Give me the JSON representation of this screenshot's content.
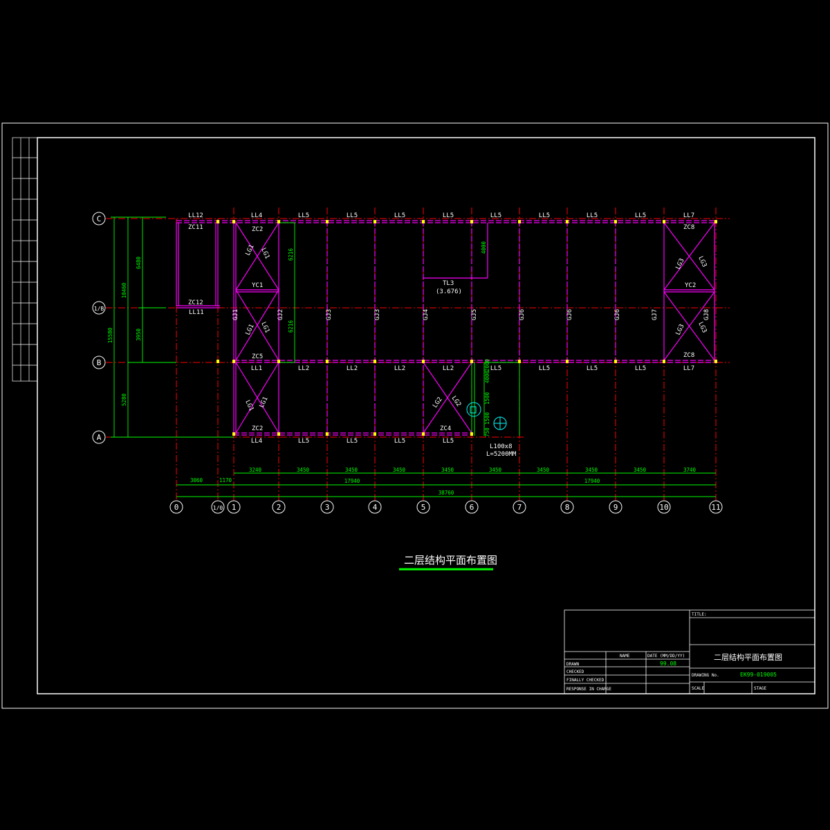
{
  "drawing_title": "二层结构平面布置图",
  "axes": {
    "columns": [
      "0",
      "1/0",
      "1",
      "2",
      "3",
      "4",
      "5",
      "6",
      "7",
      "8",
      "9",
      "10",
      "11"
    ],
    "rows": [
      "C",
      "1/B",
      "B",
      "A"
    ]
  },
  "beams_top": [
    "LL12",
    "LL4",
    "LL5",
    "LL5",
    "LL5",
    "LL5",
    "LL5",
    "LL5",
    "LL5",
    "LL5",
    "LL7"
  ],
  "beams_mid": [
    "LL1",
    "LL2",
    "LL2",
    "LL2",
    "LL2",
    "LL5",
    "LL5",
    "LL5",
    "LL5",
    "LL7"
  ],
  "beams_bottom": [
    "LL4",
    "LL5",
    "LL5",
    "LL5",
    "LL5"
  ],
  "beam_ll11": "LL11",
  "frames": [
    "GJ1",
    "GJ2",
    "GJ3",
    "GJ3",
    "GJ4",
    "GJ5",
    "GJ6",
    "GJ6",
    "GJ6",
    "GJ7",
    "GJ8"
  ],
  "braces": {
    "zc11": "ZC11",
    "zc12": "ZC12",
    "zc2": "ZC2",
    "zc5": "ZC5",
    "zc4": "ZC4",
    "zc8": "ZC8",
    "yc1": "YC1",
    "yc2": "YC2",
    "lg1": "LG1",
    "lg2": "LG2",
    "lg3": "LG3"
  },
  "tl3": {
    "name": "TL3",
    "elevation": "(3.676)"
  },
  "angle_note": {
    "size": "L100x8",
    "length": "L=5200MM"
  },
  "dims": {
    "bottom_row1": [
      "3060",
      "1170",
      "3240",
      "3450",
      "3450",
      "3450",
      "3450",
      "3450",
      "3450",
      "3450",
      "3450",
      "3740"
    ],
    "bottom_row2": [
      "17940",
      "17940"
    ],
    "bottom_total": "38760",
    "left_inner": [
      "6480",
      "3950",
      "5280"
    ],
    "left_mid": "10460",
    "left_total": "15580",
    "interior": [
      "6216",
      "6216",
      "4000",
      "4000",
      "2000",
      "1500",
      "1500",
      "750"
    ]
  },
  "title_block": {
    "title_label": "TITLE:",
    "name_header": "NAME",
    "date_header": "DATE (MM/DD/YY)",
    "rows": [
      "DRAWN",
      "CHECKED",
      "FINALLY CHECKED",
      "RESPONSE IN CHARGE"
    ],
    "date_value": "99.08",
    "drawing_name": "二层结构平面布置图",
    "drawing_no_label": "DRAWING No.",
    "drawing_no": "EK99-019005",
    "scale_label": "SCALE",
    "stage_label": "STAGE"
  },
  "colors": {
    "background": "#000000",
    "frame": "#ffffff",
    "axis_line": "#ff0000",
    "structure": "#ff00ff",
    "dimension": "#00ff00",
    "column_marker": "#ffff00",
    "detail_marker": "#00ffff"
  }
}
